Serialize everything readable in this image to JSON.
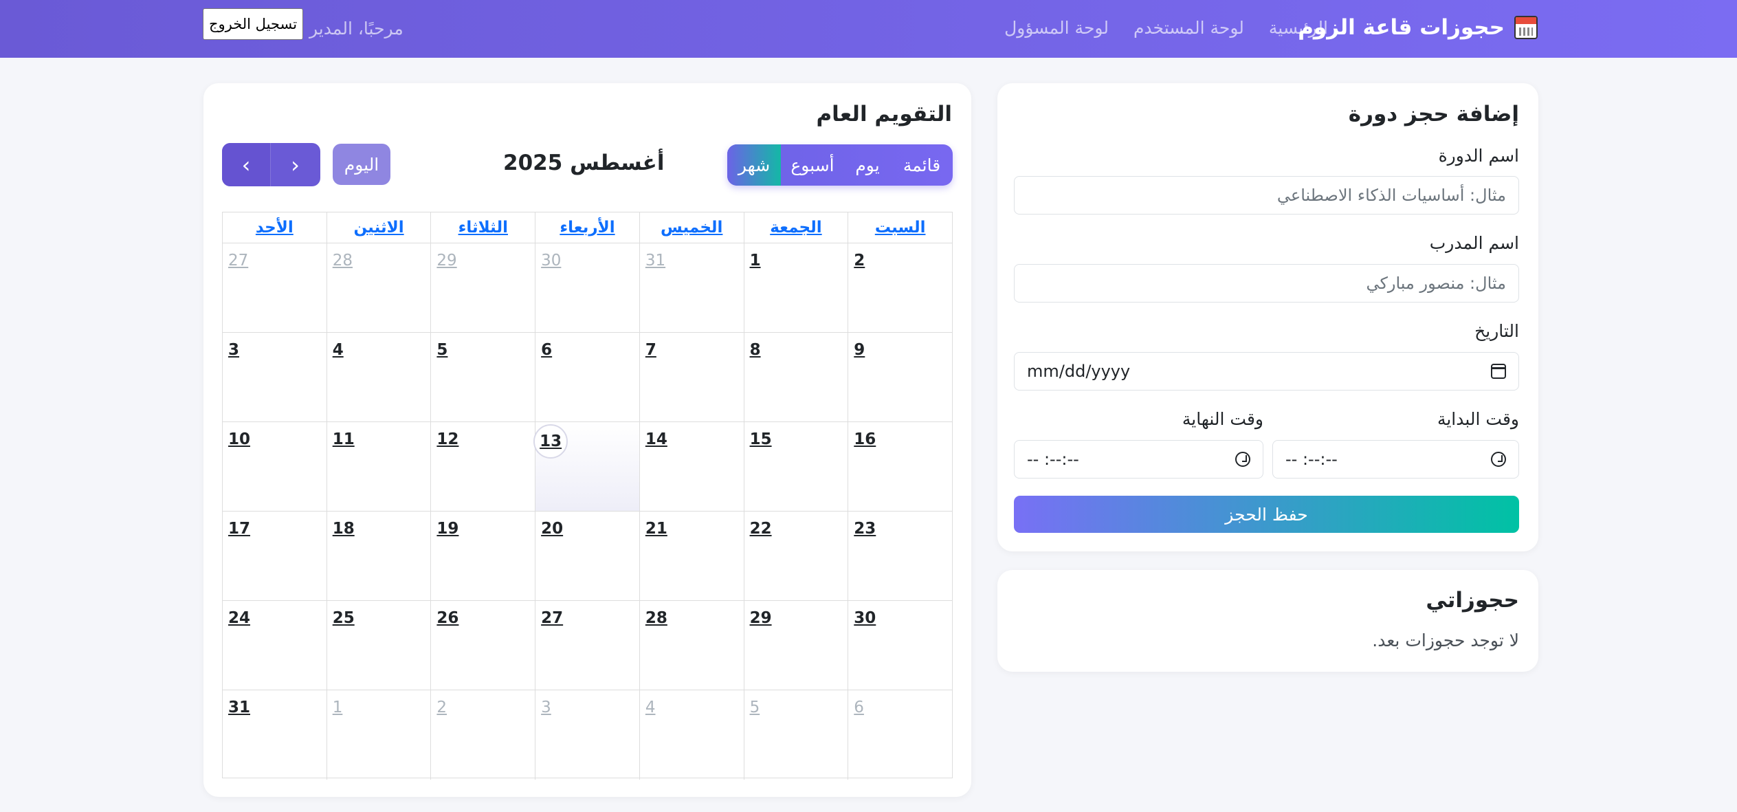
{
  "navbar": {
    "brand": "حجوزات قاعة الزوم",
    "links": [
      "الرئيسية",
      "لوحة المستخدم",
      "لوحة المسؤول"
    ],
    "welcome": "مرحبًا، المدير",
    "logout": "تسجيل الخروج"
  },
  "calendar": {
    "title": "التقويم العام",
    "views": [
      "قائمة",
      "يوم",
      "أسبوع",
      "شهر"
    ],
    "active_view": "شهر",
    "month": "أغسطس 2025",
    "today_label": "اليوم",
    "prev_icon": "chevron-left-icon",
    "next_icon": "chevron-right-icon",
    "weekdays": [
      "السبت",
      "الجمعة",
      "الخميس",
      "الأربعاء",
      "الثلاثاء",
      "الاثنين",
      "الأحد"
    ],
    "weeks": [
      [
        "2",
        "1",
        "31",
        "30",
        "29",
        "28",
        "27"
      ],
      [
        "9",
        "8",
        "7",
        "6",
        "5",
        "4",
        "3"
      ],
      [
        "16",
        "15",
        "14",
        "13",
        "12",
        "11",
        "10"
      ],
      [
        "23",
        "22",
        "21",
        "20",
        "19",
        "18",
        "17"
      ],
      [
        "30",
        "29",
        "28",
        "27",
        "26",
        "25",
        "24"
      ],
      [
        "6",
        "5",
        "4",
        "3",
        "2",
        "1",
        "31"
      ]
    ],
    "today": "13"
  },
  "form": {
    "title": "إضافة حجز دورة",
    "course_label": "اسم الدورة",
    "course_placeholder": "مثال: أساسيات الذكاء الاصطناعي",
    "trainer_label": "اسم المدرب",
    "trainer_placeholder": "مثال: منصور مباركي",
    "date_label": "التاريخ",
    "date_value": "mm/dd/yyyy",
    "start_label": "وقت البداية",
    "end_label": "وقت النهاية",
    "start_value": "-- :--:--",
    "end_value": "-- :--:--",
    "save": "حفظ الحجز"
  },
  "mine": {
    "title": "حجوزاتي",
    "empty": "لا توجد حجوزات بعد."
  }
}
